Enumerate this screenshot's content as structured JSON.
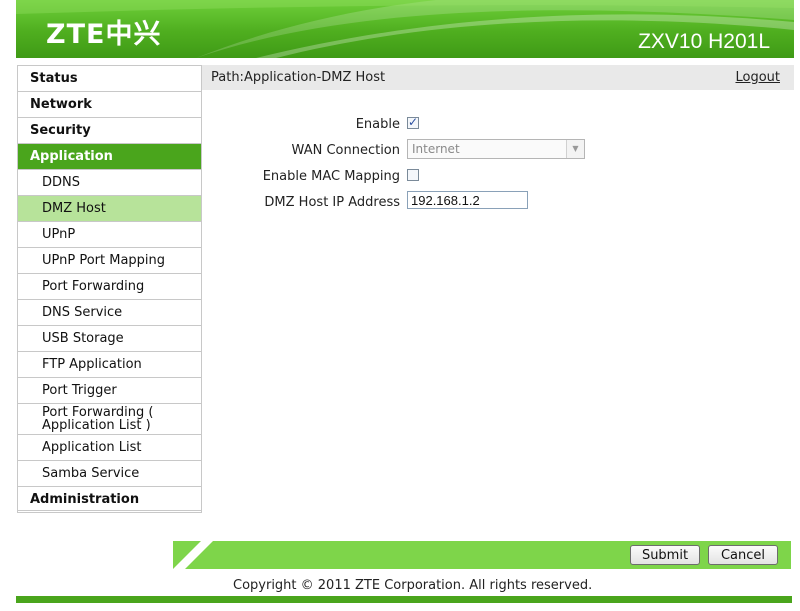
{
  "header": {
    "logo": "ZTE中兴",
    "model": "ZXV10 H201L"
  },
  "sidebar": {
    "items": [
      {
        "label": "Status"
      },
      {
        "label": "Network"
      },
      {
        "label": "Security"
      },
      {
        "label": "Application",
        "active": true
      },
      {
        "label": "Administration"
      }
    ],
    "subitems": [
      {
        "label": "DDNS"
      },
      {
        "label": "DMZ Host",
        "selected": true
      },
      {
        "label": "UPnP"
      },
      {
        "label": "UPnP Port Mapping"
      },
      {
        "label": "Port Forwarding"
      },
      {
        "label": "DNS Service"
      },
      {
        "label": "USB Storage"
      },
      {
        "label": "FTP Application"
      },
      {
        "label": "Port Trigger"
      },
      {
        "label_line1": "Port Forwarding (",
        "label_line2": "Application List )"
      },
      {
        "label": "Application List"
      },
      {
        "label": "Samba Service"
      }
    ]
  },
  "pathbar": {
    "path": "Path:Application-DMZ Host",
    "logout": "Logout"
  },
  "form": {
    "enable_label": "Enable",
    "enable_checked": true,
    "wan_label": "WAN Connection",
    "wan_value": "Internet",
    "mac_label": "Enable MAC Mapping",
    "mac_checked": false,
    "ip_label": "DMZ Host IP Address",
    "ip_value": "192.168.1.2"
  },
  "footer": {
    "submit": "Submit",
    "cancel": "Cancel",
    "copyright": "Copyright © 2011 ZTE Corporation. All rights reserved."
  },
  "colors": {
    "brand_green": "#4aa51c",
    "selected_green": "#b7e39a",
    "footer_green": "#7ed54a"
  }
}
